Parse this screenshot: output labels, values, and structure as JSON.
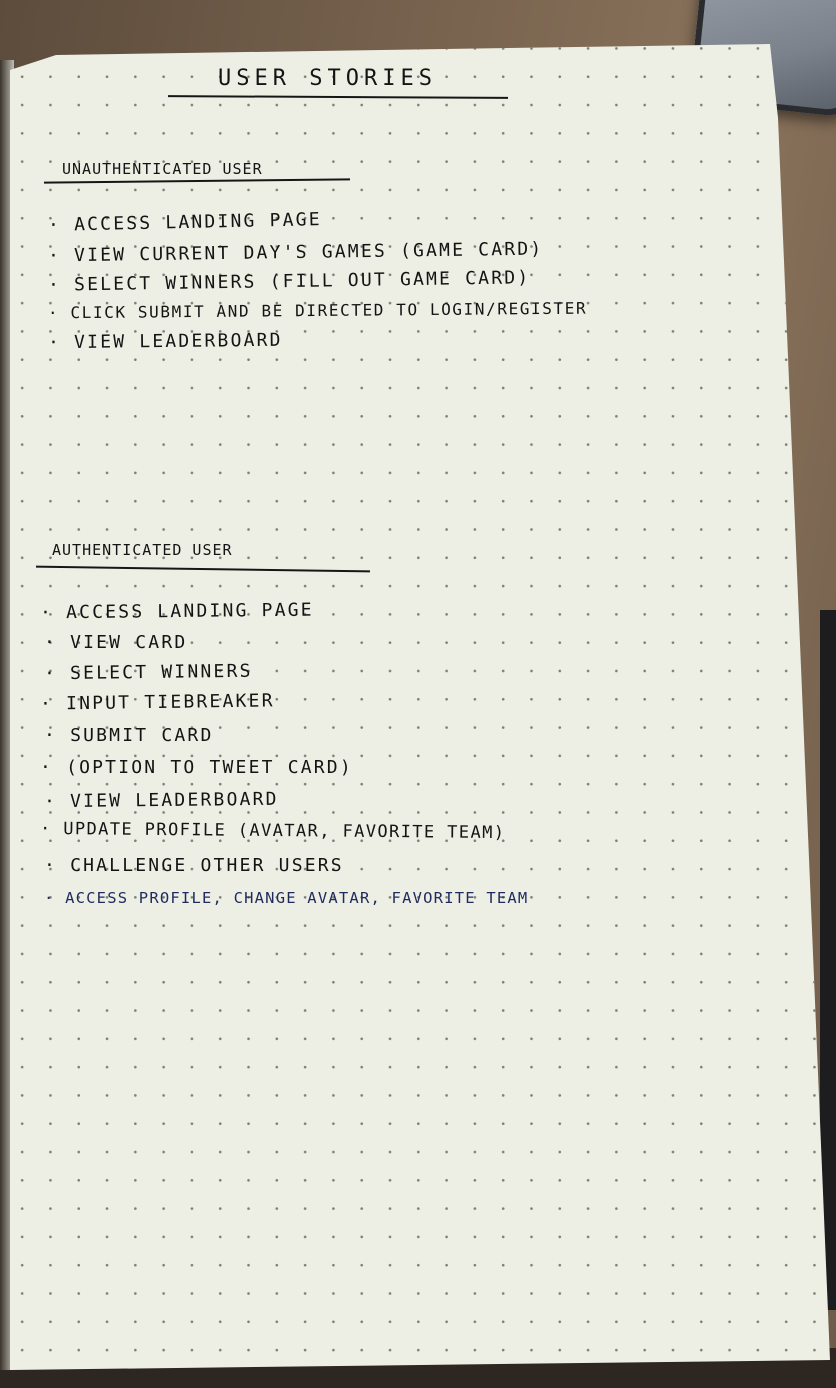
{
  "title": "User Stories",
  "sections": [
    {
      "heading": "Unauthenticated User",
      "items": [
        "Access Landing Page",
        "View Current Day's Games (Game Card)",
        "Select Winners (Fill Out Game Card)",
        "Click Submit and be Directed to Login/Register",
        "View Leaderboard"
      ]
    },
    {
      "heading": "Authenticated User",
      "items": [
        "Access Landing Page",
        "View Card",
        "Select Winners",
        "Input Tiebreaker",
        "Submit Card",
        "(Option to Tweet Card)",
        "View Leaderboard",
        "Update Profile (Avatar, Favorite Team)",
        "Challenge Other Users",
        "Access Profile, Change Avatar, Favorite Team"
      ]
    }
  ],
  "colors": {
    "paper": "#eeefe4",
    "ink_black": "#141414",
    "ink_blue": "#1f2b5e"
  }
}
